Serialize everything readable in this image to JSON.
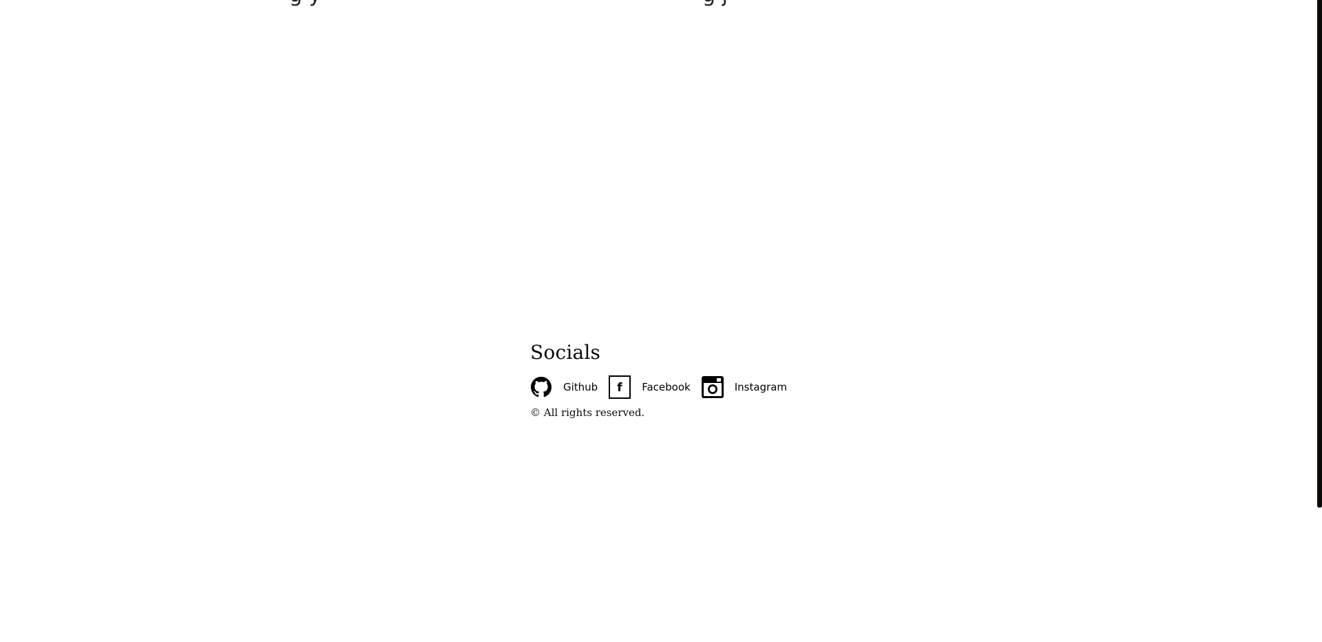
{
  "footer": {
    "socials_title": "Socials",
    "links": [
      {
        "label": "Github",
        "icon": "github-icon"
      },
      {
        "label": "Facebook",
        "icon": "facebook-icon"
      },
      {
        "label": "Instagram",
        "icon": "instagram-icon"
      }
    ],
    "copyright": "© All rights reserved."
  },
  "colors": {
    "text": "#0f0a0a",
    "background": "#ffffff",
    "scrollbar": "#0f0a0a"
  }
}
